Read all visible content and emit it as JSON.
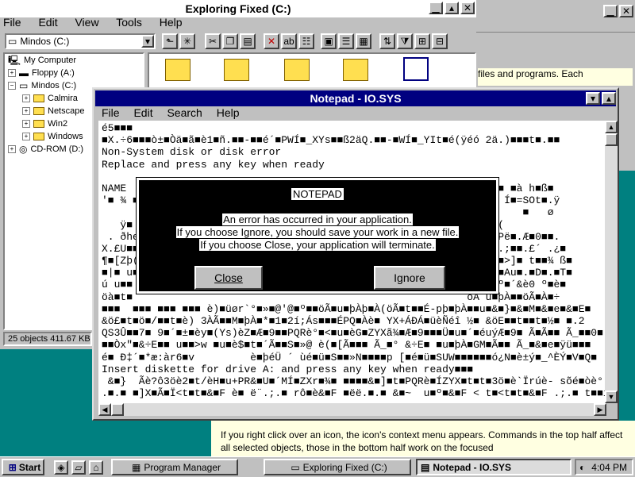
{
  "explorer": {
    "title": "Exploring Fixed (C:)",
    "menu": [
      "File",
      "Edit",
      "View",
      "Tools",
      "Help"
    ],
    "drive_selector": "Mindos (C:)",
    "tree": [
      {
        "label": "My Computer"
      },
      {
        "label": "Floppy (A:)"
      },
      {
        "label": "Mindos (C:)"
      },
      {
        "label": "Calmira"
      },
      {
        "label": "Netscape"
      },
      {
        "label": "Win2"
      },
      {
        "label": "Windows"
      },
      {
        "label": "CD-ROM (D:)"
      }
    ],
    "status": "25 objects  411.67 KB"
  },
  "help": {
    "top_text": "files and programs.  Each",
    "bottom_text": "If you right click over an icon, the icon's context menu appears.  Commands in the top half affect all selected objects, those in the bottom half work on the focused"
  },
  "notepad": {
    "title": "Notepad - IO.SYS",
    "menu": [
      "File",
      "Edit",
      "Search",
      "Help"
    ],
    "lines": [
      "é5■■■",
      "■X.÷6■■■ò±■Òä■ã■è1■ñ.■■-■■é´■PWÍ■_XYs■■ß2äQ.■■-■WÍ■_YIt■é(ÿéó 2ä.)■■■t■.■■",
      "Non-System disk or disk error",
      "Replace and press any key when ready",
      "",
      "NAME                                                      (   ■■■ ■à h■ß■",
      "'■ ¾ ■                                                      t■è0 Í■=SOt■.ÿ",
      "                                                                    ■   ø",
      "   ÿ■                                                      ■    (",
      " . ðhe■                                                    ■.€■ÕPë■.Æ■0■■.",
      "X.£U■■                                                     =ât_Y.;■■.£´ .¿■",
      "¶■[Zþ(                                                     >■üu#■>]■ t■■¾ ß■",
      "■|■ u■                                                     Ò.■D■■Au■.■D■.■T■",
      "ú u■■                                                      ?■■s■º■´&è0 º■è■",
      "öà■t■                                                      öÃ u■þÀ■■öÃ■À■÷",
      "■■■  ■■■ ■■■ ■■■ è)■üør`°■»■@'@■º■■öÃ■u■þÀþ■À(öÃ■t■■É-pþ■þÀ■■u■&■}■&■M■&■e■&■E■",
      "&ö£■t■ö■/■■t■è) 3ÀÃ■■M■þÀ■*■1■2í;Ás■■■ÉPQ■Àè■ YX+ÁÐÁ■üèÑéî ½■ &öE■■t■■t■½■ ■.2",
      "QS3Û■■7■ 9■´■±■èy■(Ys)èZ■Æ■9■■PQRè°■<■u■èG■ZYXã¾■Æ■9■■■Ü■u■´■éuýÆ■9■ Ã■Ã■■ Ã_■■0■",
      "■■Òx\"■&÷E■■ u■■>w ■u■è$■t■´Ã■■S■»@ è(■[Ã■■■ Ã_■° &÷E■ ■u■þÀ■GM■Ã■■ Ã_■&■e■ÿü■■■",
      "é■ Ð‡´■*æ:àr6■v         è■þéÜ ´ ùé■ü■S■■»N■■■■p [■é■ü■SUW■■■■■■ó¿N■è±ý■_^ÈÝ■V■Q■",
      "Insert diskette for drive A: and press any key when ready■■■",
      " &■}  Ãè?ô3öè2■t/èH■u+PR&■U■´MÍ■ZXr■¾■ ■■■■&■]■t■PQRè■ÍZYX■t■t■3ö■è`Ïrúè- sõé■òè°",
      ".■.■ ■]X■Ã■Ï<t■t■&■F è■ ë¨.;.■ rô■è&■F ■ëë.■.■ &■~  u■º■&■F < t■<t■t■&■F .;.■ t■■í"
    ]
  },
  "dialog": {
    "title": "NOTEPAD",
    "lines": [
      "An error has occurred in your application.",
      "If you choose Ignore, you should save your work in a new file.",
      "If you choose Close, your application will terminate."
    ],
    "close_label": "Close",
    "ignore_label": "Ignore"
  },
  "taskbar": {
    "start_label": "Start",
    "tasks": [
      "Program Manager",
      "Exploring Fixed (C:)",
      "Notepad - IO.SYS"
    ],
    "clock": "4:04 PM"
  }
}
